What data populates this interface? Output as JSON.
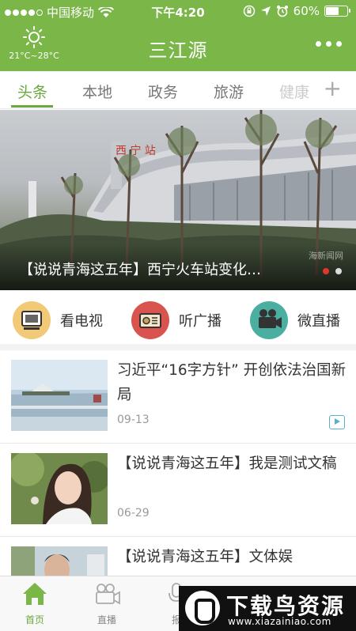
{
  "status_bar": {
    "carrier": "中国移动",
    "time": "下午4:20",
    "battery": "60%",
    "battery_level": 0.6,
    "icons": [
      "signal-dots",
      "wifi-icon",
      "rotation-lock-icon",
      "location-icon",
      "alarm-icon",
      "battery-icon"
    ]
  },
  "header": {
    "title": "三江源",
    "weather_icon": "sun-icon",
    "temperature": "21°C~28°C",
    "more_icon": "more-dots-icon"
  },
  "tabs": {
    "items": [
      "头条",
      "本地",
      "政务",
      "旅游",
      "健康"
    ],
    "active_index": 0,
    "add_icon": "plus-icon"
  },
  "banner": {
    "caption": "【说说青海这五年】西宁火车站变化…",
    "watermark": "海新闻网",
    "sign_text": "西 宁 站",
    "slide_count": 2,
    "active_slide": 0
  },
  "quick_links": [
    {
      "label": "看电视",
      "icon": "tv-icon",
      "color": "#f2c977"
    },
    {
      "label": "听广播",
      "icon": "radio-icon",
      "color": "#d9534f"
    },
    {
      "label": "微直播",
      "icon": "camera-icon",
      "color": "#4aaea0"
    }
  ],
  "news": [
    {
      "title": "习近平“16字方针” 开创依法治国新局",
      "date": "09-13",
      "has_video": true,
      "thumb": "lake-pavilion-photo"
    },
    {
      "title": "【说说青海这五年】我是测试文稿",
      "date": "06-29",
      "has_video": false,
      "thumb": "portrait-woman-photo"
    },
    {
      "title": "【说说青海这五年】文体娱",
      "date": "",
      "has_video": false,
      "thumb": "man-portrait-photo"
    }
  ],
  "bottom_tabs": [
    {
      "label": "首页",
      "icon": "home-icon",
      "active": true
    },
    {
      "label": "直播",
      "icon": "video-camera-icon",
      "active": false
    },
    {
      "label": "报",
      "icon": "microphone-icon",
      "active": false
    }
  ],
  "site_logo": {
    "name": "下载鸟资源",
    "url": "www.xiazainiao.com"
  },
  "colors": {
    "brand_green": "#7ab648",
    "active_green": "#6aa83e",
    "dot_active": "#e0362c"
  }
}
